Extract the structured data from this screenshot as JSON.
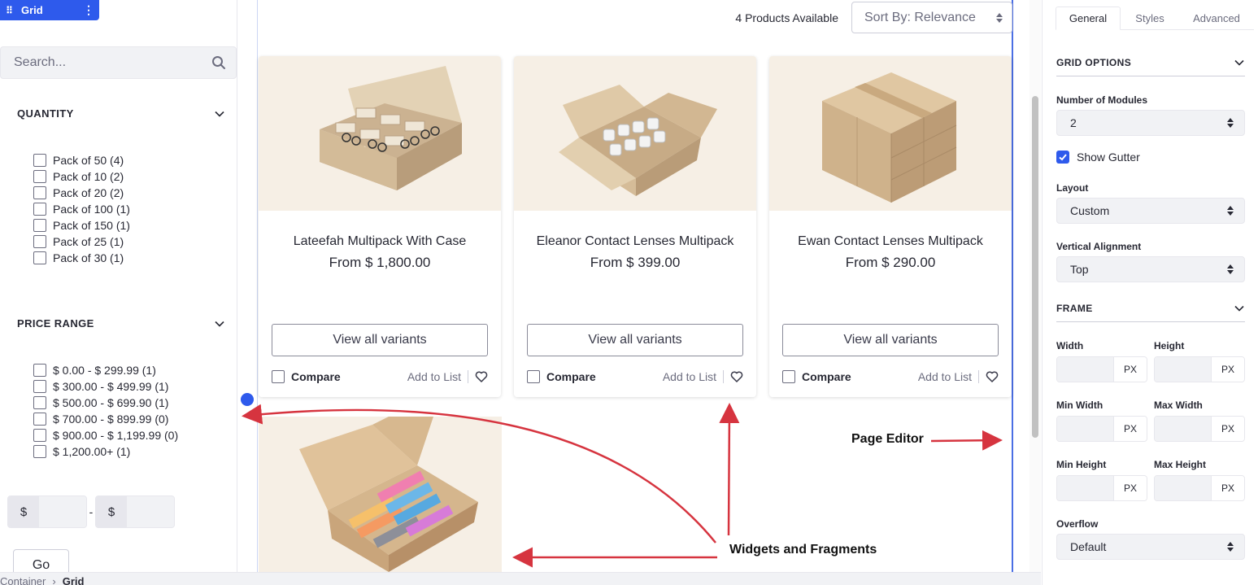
{
  "grid_badge": {
    "label": "Grid",
    "drag_icon": "drag-handle-icon",
    "menu_icon": "kebab-menu-icon"
  },
  "search": {
    "placeholder": "Search...",
    "icon": "search-icon"
  },
  "filters": {
    "quantity": {
      "title": "QUANTITY",
      "options": [
        "Pack of 50 (4)",
        "Pack of 10 (2)",
        "Pack of 20 (2)",
        "Pack of 100 (1)",
        "Pack of 150 (1)",
        "Pack of 25 (1)",
        "Pack of 30 (1)"
      ]
    },
    "price_range": {
      "title": "PRICE RANGE",
      "options": [
        "$ 0.00 - $ 299.99 (1)",
        "$ 300.00 - $ 499.99 (1)",
        "$ 500.00 - $ 699.90 (1)",
        "$ 700.00 - $ 899.99 (0)",
        "$ 900.00 - $ 1,199.99 (0)",
        "$ 1,200.00+ (1)"
      ]
    },
    "min_currency": "$",
    "separator": "-",
    "max_currency": "$",
    "go_label": "Go"
  },
  "breadcrumb": {
    "items": [
      "Container",
      "Grid"
    ],
    "separator": "›"
  },
  "catalog": {
    "count_text": "4 Products Available",
    "sort_label": "Sort By:  Relevance",
    "products": [
      {
        "name": "Lateefah Multipack With Case",
        "price": "From $ 1,800.00",
        "variants_label": "View all variants",
        "compare_label": "Compare",
        "add_to_list_label": "Add to List"
      },
      {
        "name": "Eleanor Contact Lenses Multipack",
        "price": "From $ 399.00",
        "variants_label": "View all variants",
        "compare_label": "Compare",
        "add_to_list_label": "Add to List"
      },
      {
        "name": "Ewan Contact Lenses Multipack",
        "price": "From $ 290.00",
        "variants_label": "View all variants",
        "compare_label": "Compare",
        "add_to_list_label": "Add to List"
      }
    ]
  },
  "annotations": {
    "page_editor": "Page Editor",
    "widgets": "Widgets and Fragments",
    "arrow_color": "#d6343f"
  },
  "settings": {
    "tabs": [
      "General",
      "Styles",
      "Advanced"
    ],
    "active_tab": "General",
    "grid_options_title": "GRID OPTIONS",
    "modules_label": "Number of Modules",
    "modules_value": "2",
    "gutter_label": "Show Gutter",
    "gutter_checked": true,
    "layout_label": "Layout",
    "layout_value": "Custom",
    "valign_label": "Vertical Alignment",
    "valign_value": "Top",
    "frame_title": "FRAME",
    "width_label": "Width",
    "height_label": "Height",
    "min_width_label": "Min Width",
    "max_width_label": "Max Width",
    "min_height_label": "Min Height",
    "max_height_label": "Max Height",
    "unit": "PX",
    "overflow_label": "Overflow",
    "overflow_value": "Default"
  },
  "colors": {
    "accent": "#2e5aec",
    "panel_bg": "#f1f2f5",
    "product_bg": "#f6efe5",
    "annotation_arrow": "#d6343f"
  }
}
